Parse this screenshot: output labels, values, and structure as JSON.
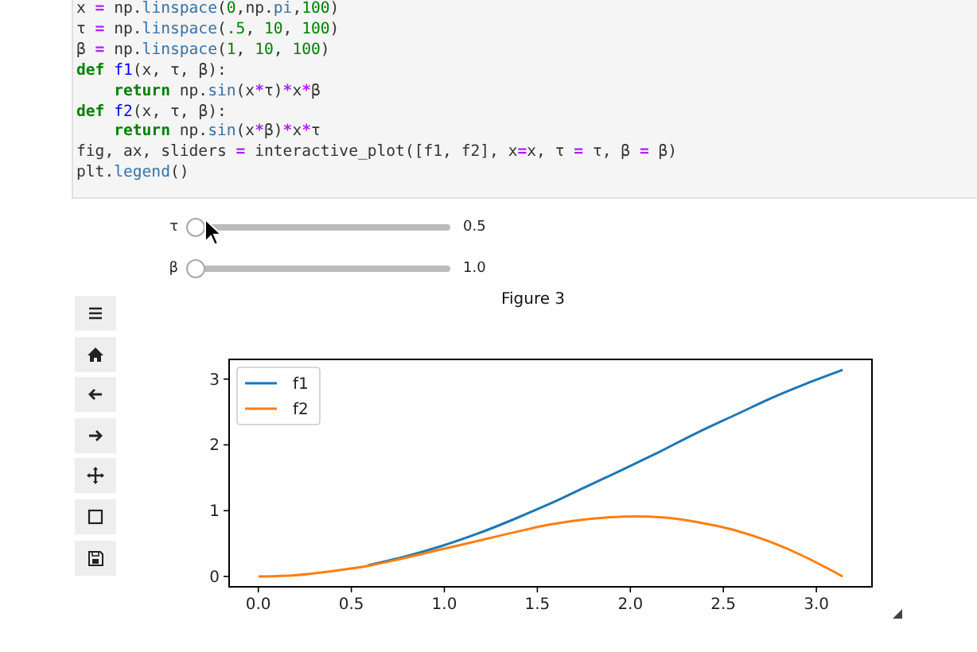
{
  "code_cell": {
    "lines": [
      [
        {
          "text": "x ",
          "kind": "plain"
        },
        {
          "text": "=",
          "kind": "op"
        },
        {
          "text": " np.",
          "kind": "plain"
        },
        {
          "text": "linspace",
          "kind": "attr"
        },
        {
          "text": "(",
          "kind": "plain"
        },
        {
          "text": "0",
          "kind": "num"
        },
        {
          "text": ",np.",
          "kind": "plain"
        },
        {
          "text": "pi",
          "kind": "attr"
        },
        {
          "text": ",",
          "kind": "plain"
        },
        {
          "text": "100",
          "kind": "num"
        },
        {
          "text": ")",
          "kind": "plain"
        }
      ],
      [
        {
          "text": "τ ",
          "kind": "plain"
        },
        {
          "text": "=",
          "kind": "op"
        },
        {
          "text": " np.",
          "kind": "plain"
        },
        {
          "text": "linspace",
          "kind": "attr"
        },
        {
          "text": "(",
          "kind": "plain"
        },
        {
          "text": ".5",
          "kind": "num"
        },
        {
          "text": ", ",
          "kind": "plain"
        },
        {
          "text": "10",
          "kind": "num"
        },
        {
          "text": ", ",
          "kind": "plain"
        },
        {
          "text": "100",
          "kind": "num"
        },
        {
          "text": ")",
          "kind": "plain"
        }
      ],
      [
        {
          "text": "β ",
          "kind": "plain"
        },
        {
          "text": "=",
          "kind": "op"
        },
        {
          "text": " np.",
          "kind": "plain"
        },
        {
          "text": "linspace",
          "kind": "attr"
        },
        {
          "text": "(",
          "kind": "plain"
        },
        {
          "text": "1",
          "kind": "num"
        },
        {
          "text": ", ",
          "kind": "plain"
        },
        {
          "text": "10",
          "kind": "num"
        },
        {
          "text": ", ",
          "kind": "plain"
        },
        {
          "text": "100",
          "kind": "num"
        },
        {
          "text": ")",
          "kind": "plain"
        }
      ],
      [
        {
          "text": "def",
          "kind": "kw"
        },
        {
          "text": " f1",
          "kind": "def"
        },
        {
          "text": "(x, τ, β):",
          "kind": "plain"
        }
      ],
      [
        {
          "text": "    return",
          "kind": "kw"
        },
        {
          "text": " np.",
          "kind": "plain"
        },
        {
          "text": "sin",
          "kind": "attr"
        },
        {
          "text": "(x",
          "kind": "plain"
        },
        {
          "text": "*",
          "kind": "op"
        },
        {
          "text": "τ)",
          "kind": "plain"
        },
        {
          "text": "*",
          "kind": "op"
        },
        {
          "text": "x",
          "kind": "plain"
        },
        {
          "text": "*",
          "kind": "op"
        },
        {
          "text": "β",
          "kind": "plain"
        }
      ],
      [
        {
          "text": "def",
          "kind": "kw"
        },
        {
          "text": " f2",
          "kind": "def"
        },
        {
          "text": "(x, τ, β):",
          "kind": "plain"
        }
      ],
      [
        {
          "text": "    return",
          "kind": "kw"
        },
        {
          "text": " np.",
          "kind": "plain"
        },
        {
          "text": "sin",
          "kind": "attr"
        },
        {
          "text": "(x",
          "kind": "plain"
        },
        {
          "text": "*",
          "kind": "op"
        },
        {
          "text": "β)",
          "kind": "plain"
        },
        {
          "text": "*",
          "kind": "op"
        },
        {
          "text": "x",
          "kind": "plain"
        },
        {
          "text": "*",
          "kind": "op"
        },
        {
          "text": "τ",
          "kind": "plain"
        }
      ],
      [
        {
          "text": "fig, ax, sliders ",
          "kind": "plain"
        },
        {
          "text": "=",
          "kind": "op"
        },
        {
          "text": " interactive_plot([f1, f2], x",
          "kind": "plain"
        },
        {
          "text": "=",
          "kind": "op"
        },
        {
          "text": "x, τ ",
          "kind": "plain"
        },
        {
          "text": "=",
          "kind": "op"
        },
        {
          "text": " τ, β ",
          "kind": "plain"
        },
        {
          "text": "=",
          "kind": "op"
        },
        {
          "text": " β)",
          "kind": "plain"
        }
      ],
      [
        {
          "text": "plt.",
          "kind": "plain"
        },
        {
          "text": "legend",
          "kind": "attr"
        },
        {
          "text": "()",
          "kind": "plain"
        }
      ]
    ]
  },
  "sliders": [
    {
      "label": "τ",
      "level": 0,
      "reading": "0.5"
    },
    {
      "label": "β",
      "level": 0,
      "reading": "1.0"
    }
  ],
  "figure": {
    "title": "Figure 3",
    "chart_data": {
      "type": "line",
      "x": [
        0,
        0.196,
        0.393,
        0.589,
        0.785,
        0.982,
        1.178,
        1.374,
        1.571,
        1.767,
        1.963,
        2.16,
        2.356,
        2.553,
        2.749,
        2.945,
        3.142
      ],
      "series": [
        {
          "name": "f1",
          "color": "#1f77b4",
          "values": [
            null,
            null,
            null,
            0.17,
            0.3,
            0.46,
            0.65,
            0.87,
            1.11,
            1.37,
            1.63,
            1.9,
            2.18,
            2.44,
            2.7,
            2.93,
            3.14
          ]
        },
        {
          "name": "f2",
          "color": "#ff7f0e",
          "values": [
            0,
            0.02,
            0.08,
            0.16,
            0.28,
            0.41,
            0.54,
            0.67,
            0.79,
            0.87,
            0.91,
            0.9,
            0.83,
            0.71,
            0.53,
            0.29,
            0
          ]
        }
      ],
      "legend": "upper left",
      "xlim": [
        -0.157,
        3.299
      ],
      "ylim": [
        -0.157,
        3.299
      ],
      "xticks": [
        {
          "value": 0,
          "label": "0.0"
        },
        {
          "value": 0.5,
          "label": "0.5"
        },
        {
          "value": 1,
          "label": "1.0"
        },
        {
          "value": 1.5,
          "label": "1.5"
        },
        {
          "value": 2,
          "label": "2.0"
        },
        {
          "value": 2.5,
          "label": "2.5"
        },
        {
          "value": 3,
          "label": "3.0"
        }
      ],
      "yticks": [
        0,
        1,
        2,
        3
      ]
    }
  }
}
